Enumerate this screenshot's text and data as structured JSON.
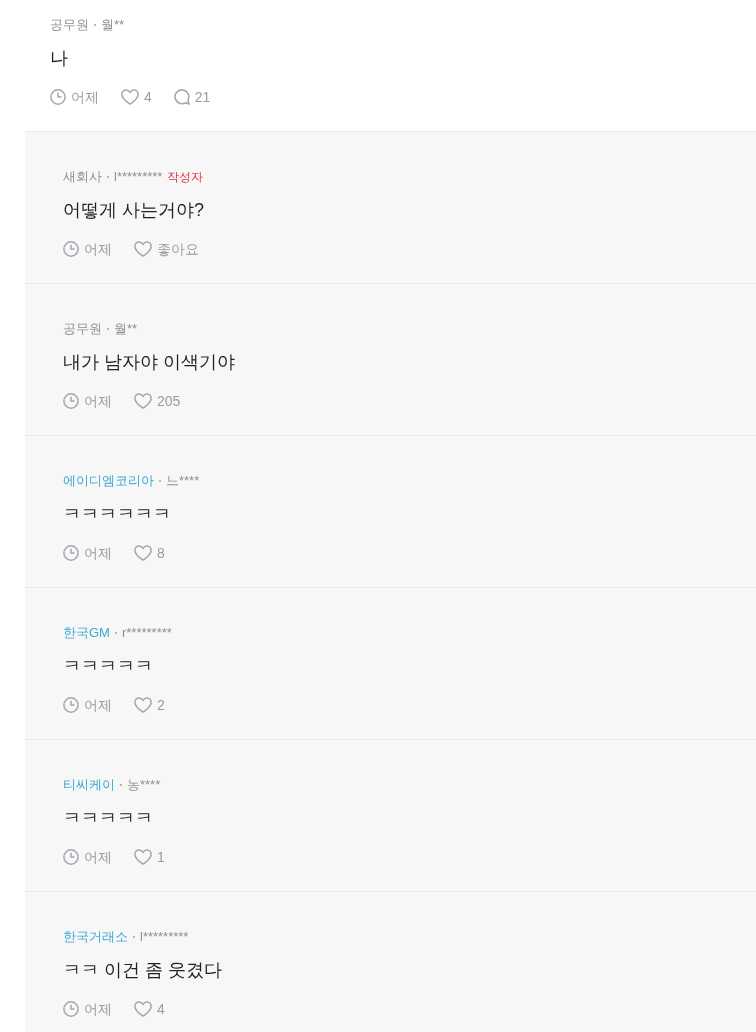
{
  "comment": {
    "company": "공무원",
    "company_link": false,
    "nickname": "월**",
    "body": "나",
    "time": "어제",
    "likes": "4",
    "reply_count": "21"
  },
  "replies": [
    {
      "company": "새회사",
      "company_link": false,
      "nickname": "l*********",
      "author_tag": "작성자",
      "body": "어떻게 사는거야?",
      "time": "어제",
      "likes": "좋아요"
    },
    {
      "company": "공무원",
      "company_link": false,
      "nickname": "월**",
      "body": "내가 남자야 이색기야",
      "time": "어제",
      "likes": "205"
    },
    {
      "company": "에이디엠코리아",
      "company_link": true,
      "nickname": "느****",
      "body": "ㅋㅋㅋㅋㅋㅋ",
      "time": "어제",
      "likes": "8"
    },
    {
      "company": "한국GM",
      "company_link": true,
      "nickname": "r*********",
      "body": "ㅋㅋㅋㅋㅋ",
      "time": "어제",
      "likes": "2"
    },
    {
      "company": "티씨케이",
      "company_link": true,
      "nickname": "농****",
      "body": "ㅋㅋㅋㅋㅋ",
      "time": "어제",
      "likes": "1"
    },
    {
      "company": "한국거래소",
      "company_link": true,
      "nickname": "l*********",
      "body": "ㅋㅋ 이건 좀 웃겼다",
      "time": "어제",
      "likes": "4"
    }
  ]
}
